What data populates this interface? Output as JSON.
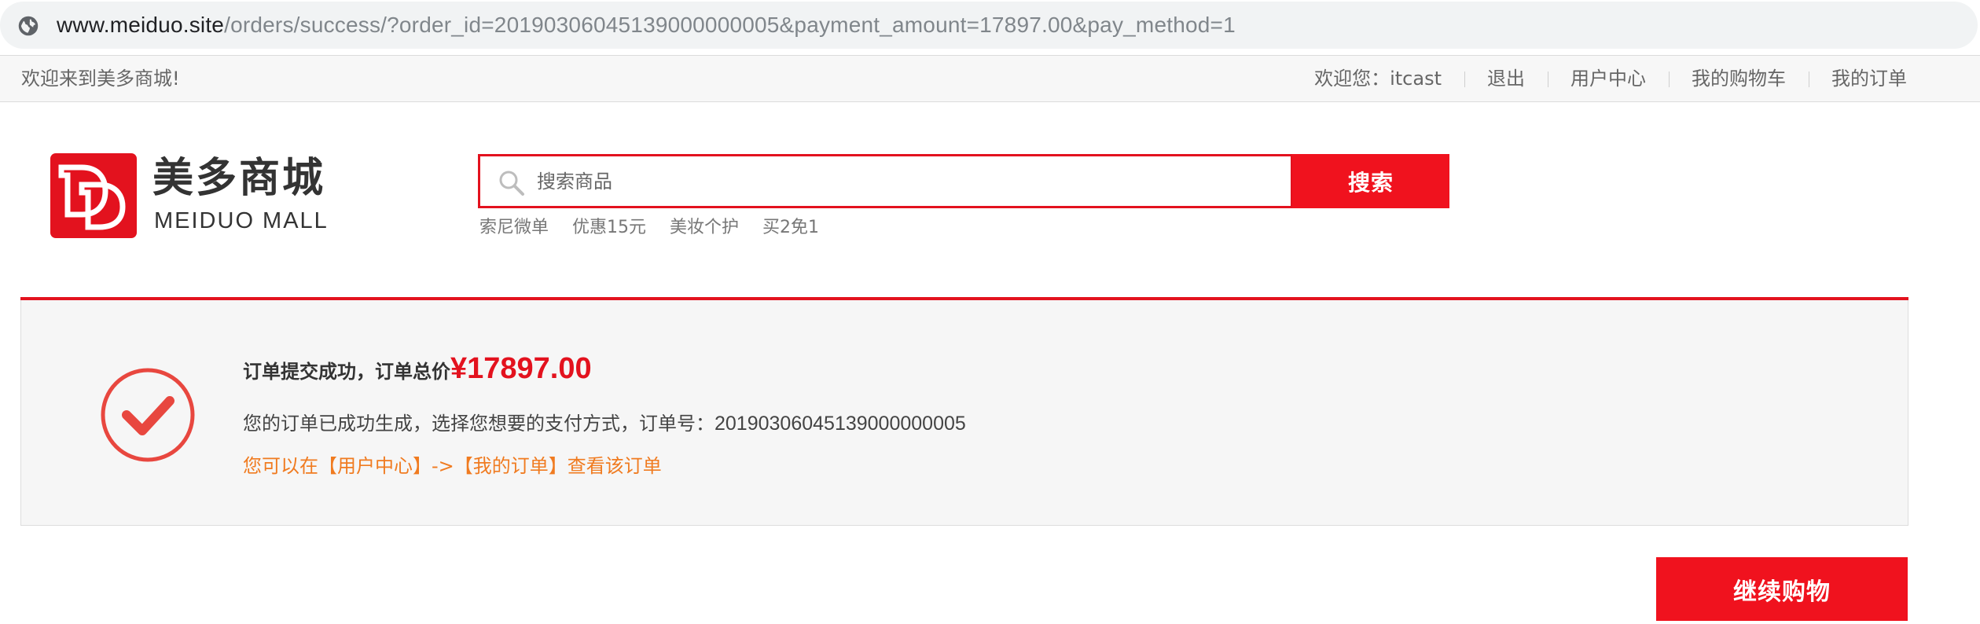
{
  "browser": {
    "url_host": "www.meiduo.site",
    "url_rest": "/orders/success/?order_id=20190306045139000000005&payment_amount=17897.00&pay_method=1",
    "site_icon": "globe-icon"
  },
  "topbar": {
    "welcome": "欢迎来到美多商城!",
    "greeting": "欢迎您：itcast",
    "logout": "退出",
    "user_center": "用户中心",
    "cart": "我的购物车",
    "orders": "我的订单"
  },
  "header": {
    "logo_cn": "美多商城",
    "logo_en": "MEIDUO MALL",
    "search_placeholder": "搜索商品",
    "search_button": "搜索",
    "hot_words": [
      "索尼微单",
      "优惠15元",
      "美妆个护",
      "买2免1"
    ]
  },
  "success": {
    "title_label": "订单提交成功，订单总价",
    "amount": "¥17897.00",
    "detail_label": "您的订单已成功生成，选择您想要的支付方式，订单号：",
    "order_id": "20190306045139000000005",
    "link_text": "您可以在【用户中心】->【我的订单】查看该订单",
    "icon": "check-circle-icon"
  },
  "actions": {
    "continue_shopping": "继续购物"
  },
  "colors": {
    "brand_red": "#e3121e",
    "link_orange": "#f07b20",
    "panel_bg": "#f6f6f6"
  }
}
